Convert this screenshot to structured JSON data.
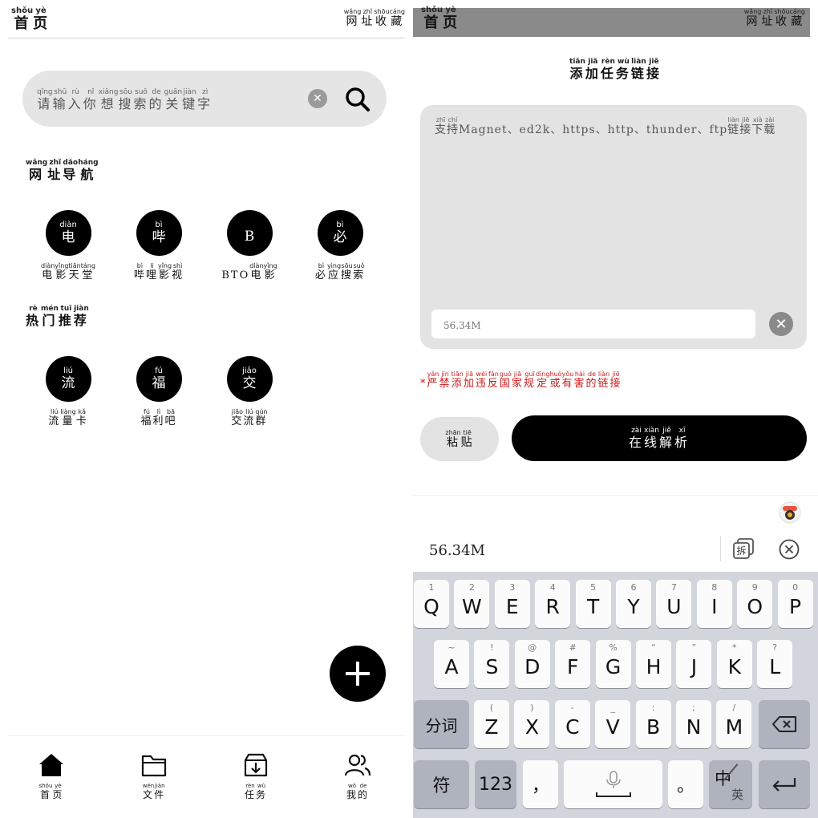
{
  "left": {
    "top_bar": {
      "home_title": [
        {
          "c": "首",
          "p": "shǒu"
        },
        {
          "c": "页",
          "p": "yè"
        }
      ],
      "favorites": [
        {
          "c": "网",
          "p": "wǎng"
        },
        {
          "c": "址",
          "p": "zhǐ"
        },
        {
          "c": "收",
          "p": "shōu"
        },
        {
          "c": "藏",
          "p": "cáng"
        }
      ]
    },
    "search": {
      "placeholder": [
        {
          "c": "请",
          "p": "qǐng"
        },
        {
          "c": "输",
          "p": "shū"
        },
        {
          "c": "入",
          "p": "rù"
        },
        {
          "c": "你",
          "p": "nǐ"
        },
        {
          "c": "想",
          "p": "xiǎng"
        },
        {
          "c": "搜",
          "p": "sōu"
        },
        {
          "c": "索",
          "p": "suǒ"
        },
        {
          "c": "的",
          "p": "de"
        },
        {
          "c": "关",
          "p": "guān"
        },
        {
          "c": "键",
          "p": "jiàn"
        },
        {
          "c": "字",
          "p": "zì"
        }
      ],
      "clear_icon": "clear-icon",
      "search_icon": "search-icon"
    },
    "nav_section": {
      "title": [
        {
          "c": "网",
          "p": "wǎng"
        },
        {
          "c": "址",
          "p": "zhǐ"
        },
        {
          "c": "导",
          "p": "dǎo"
        },
        {
          "c": "航",
          "p": "háng"
        }
      ],
      "items": [
        {
          "circle": [
            {
              "c": "电",
              "p": "diàn"
            }
          ],
          "label": [
            {
              "c": "电",
              "p": "diàn"
            },
            {
              "c": "影",
              "p": "yǐng"
            },
            {
              "c": "天",
              "p": "tiān"
            },
            {
              "c": "堂",
              "p": "táng"
            }
          ]
        },
        {
          "circle": [
            {
              "c": "哔",
              "p": "bì"
            }
          ],
          "label": [
            {
              "c": "哔",
              "p": "bì"
            },
            {
              "c": "哩",
              "p": "li"
            },
            {
              "c": "影",
              "p": "yǐng"
            },
            {
              "c": "视",
              "p": "shì"
            }
          ]
        },
        {
          "circle": [
            {
              "c": "B",
              "p": ""
            }
          ],
          "label": [
            {
              "c": "BTO",
              "p": ""
            },
            {
              "c": "电",
              "p": "diàn"
            },
            {
              "c": "影",
              "p": "yǐng"
            }
          ]
        },
        {
          "circle": [
            {
              "c": "必",
              "p": "bì"
            }
          ],
          "label": [
            {
              "c": "必",
              "p": "bì"
            },
            {
              "c": "应",
              "p": "yìng"
            },
            {
              "c": "搜",
              "p": "sōu"
            },
            {
              "c": "索",
              "p": "suǒ"
            }
          ]
        }
      ]
    },
    "hot_section": {
      "title": [
        {
          "c": "热",
          "p": "rè"
        },
        {
          "c": "门",
          "p": "mén"
        },
        {
          "c": "推",
          "p": "tuī"
        },
        {
          "c": "荐",
          "p": "jiàn"
        }
      ],
      "items": [
        {
          "circle": [
            {
              "c": "流",
              "p": "liú"
            }
          ],
          "label": [
            {
              "c": "流",
              "p": "liú"
            },
            {
              "c": "量",
              "p": "liàng"
            },
            {
              "c": "卡",
              "p": "kǎ"
            }
          ]
        },
        {
          "circle": [
            {
              "c": "福",
              "p": "fú"
            }
          ],
          "label": [
            {
              "c": "福",
              "p": "fú"
            },
            {
              "c": "利",
              "p": "lì"
            },
            {
              "c": "吧",
              "p": "bā"
            }
          ]
        },
        {
          "circle": [
            {
              "c": "交",
              "p": "jiāo"
            }
          ],
          "label": [
            {
              "c": "交",
              "p": "jiāo"
            },
            {
              "c": "流",
              "p": "liú"
            },
            {
              "c": "群",
              "p": "qún"
            }
          ]
        }
      ]
    },
    "fab_icon": "plus-icon",
    "bottom_nav": [
      {
        "icon": "home-icon",
        "label": [
          {
            "c": "首",
            "p": "shǒu"
          },
          {
            "c": "页",
            "p": "yè"
          }
        ],
        "active": true
      },
      {
        "icon": "folder-icon",
        "label": [
          {
            "c": "文",
            "p": "wén"
          },
          {
            "c": "件",
            "p": "jiàn"
          }
        ],
        "active": false
      },
      {
        "icon": "download-box-icon",
        "label": [
          {
            "c": "任",
            "p": "rèn"
          },
          {
            "c": "务",
            "p": "wù"
          }
        ],
        "active": false
      },
      {
        "icon": "users-icon",
        "label": [
          {
            "c": "我",
            "p": "wǒ"
          },
          {
            "c": "的",
            "p": "de"
          }
        ],
        "active": false
      }
    ]
  },
  "right": {
    "top_bar": {
      "home_title": [
        {
          "c": "首",
          "p": "shǒu"
        },
        {
          "c": "页",
          "p": "yè"
        }
      ],
      "favorites": [
        {
          "c": "网",
          "p": "wǎng"
        },
        {
          "c": "址",
          "p": "zhǐ"
        },
        {
          "c": "收",
          "p": "shōu"
        },
        {
          "c": "藏",
          "p": "cáng"
        }
      ]
    },
    "sheet_title": [
      {
        "c": "添",
        "p": "tiān"
      },
      {
        "c": "加",
        "p": "jiā"
      },
      {
        "c": "任",
        "p": "rèn"
      },
      {
        "c": "务",
        "p": "wù"
      },
      {
        "c": "链",
        "p": "liàn"
      },
      {
        "c": "接",
        "p": "jiē"
      }
    ],
    "link_placeholder": [
      {
        "c": "支",
        "p": "zhī"
      },
      {
        "c": "持",
        "p": "chí"
      },
      {
        "c": "Magnet、ed2k、https、http、thunder、ftp",
        "p": ""
      },
      {
        "c": "链",
        "p": "liàn"
      },
      {
        "c": "接",
        "p": "jiē"
      },
      {
        "c": "下",
        "p": "xià"
      },
      {
        "c": "载",
        "p": "zài"
      }
    ],
    "size_input_value": "56.34M",
    "warning": [
      {
        "c": "*",
        "p": ""
      },
      {
        "c": "严",
        "p": "yán"
      },
      {
        "c": "禁",
        "p": "jìn"
      },
      {
        "c": "添",
        "p": "tiān"
      },
      {
        "c": "加",
        "p": "jiā"
      },
      {
        "c": "违",
        "p": "wéi"
      },
      {
        "c": "反",
        "p": "fǎn"
      },
      {
        "c": "国",
        "p": "guó"
      },
      {
        "c": "家",
        "p": "jiā"
      },
      {
        "c": "规",
        "p": "guī"
      },
      {
        "c": "定",
        "p": "dìng"
      },
      {
        "c": "或",
        "p": "huò"
      },
      {
        "c": "有",
        "p": "yǒu"
      },
      {
        "c": "害",
        "p": "hài"
      },
      {
        "c": "的",
        "p": "de"
      },
      {
        "c": "链",
        "p": "liàn"
      },
      {
        "c": "接",
        "p": "jiē"
      }
    ],
    "paste_button": [
      {
        "c": "粘",
        "p": "zhān"
      },
      {
        "c": "贴",
        "p": "tiē"
      }
    ],
    "parse_button": [
      {
        "c": "在",
        "p": "zài"
      },
      {
        "c": "线",
        "p": "xiàn"
      },
      {
        "c": "解",
        "p": "jiě"
      },
      {
        "c": "析",
        "p": "xī"
      }
    ],
    "colors": {
      "warning": "#cc1a1a",
      "overlay_bar": "#8a8a8a",
      "field_bg": "#e3e3e3"
    }
  },
  "keyboard": {
    "candidate": "56.34M",
    "split_icon_text": "拆",
    "row1": [
      {
        "k": "Q",
        "s": "1"
      },
      {
        "k": "W",
        "s": "2"
      },
      {
        "k": "E",
        "s": "3"
      },
      {
        "k": "R",
        "s": "4"
      },
      {
        "k": "T",
        "s": "5"
      },
      {
        "k": "Y",
        "s": "6"
      },
      {
        "k": "U",
        "s": "7"
      },
      {
        "k": "I",
        "s": "8"
      },
      {
        "k": "O",
        "s": "9"
      },
      {
        "k": "P",
        "s": "0"
      }
    ],
    "row2": [
      {
        "k": "A",
        "s": "~"
      },
      {
        "k": "S",
        "s": "!"
      },
      {
        "k": "D",
        "s": "@"
      },
      {
        "k": "F",
        "s": "#"
      },
      {
        "k": "G",
        "s": "%"
      },
      {
        "k": "H",
        "s": "“"
      },
      {
        "k": "J",
        "s": "”"
      },
      {
        "k": "K",
        "s": "*"
      },
      {
        "k": "L",
        "s": "?"
      }
    ],
    "row3": [
      {
        "k": "Z",
        "s": "("
      },
      {
        "k": "X",
        "s": ")"
      },
      {
        "k": "C",
        "s": "-"
      },
      {
        "k": "V",
        "s": "_"
      },
      {
        "k": "B",
        "s": ":"
      },
      {
        "k": "N",
        "s": ";"
      },
      {
        "k": "M",
        "s": "/"
      }
    ],
    "fenci": "分词",
    "fu": "符",
    "num": "123",
    "comma": "，",
    "period": "。",
    "zh": "中",
    "en": "英"
  }
}
